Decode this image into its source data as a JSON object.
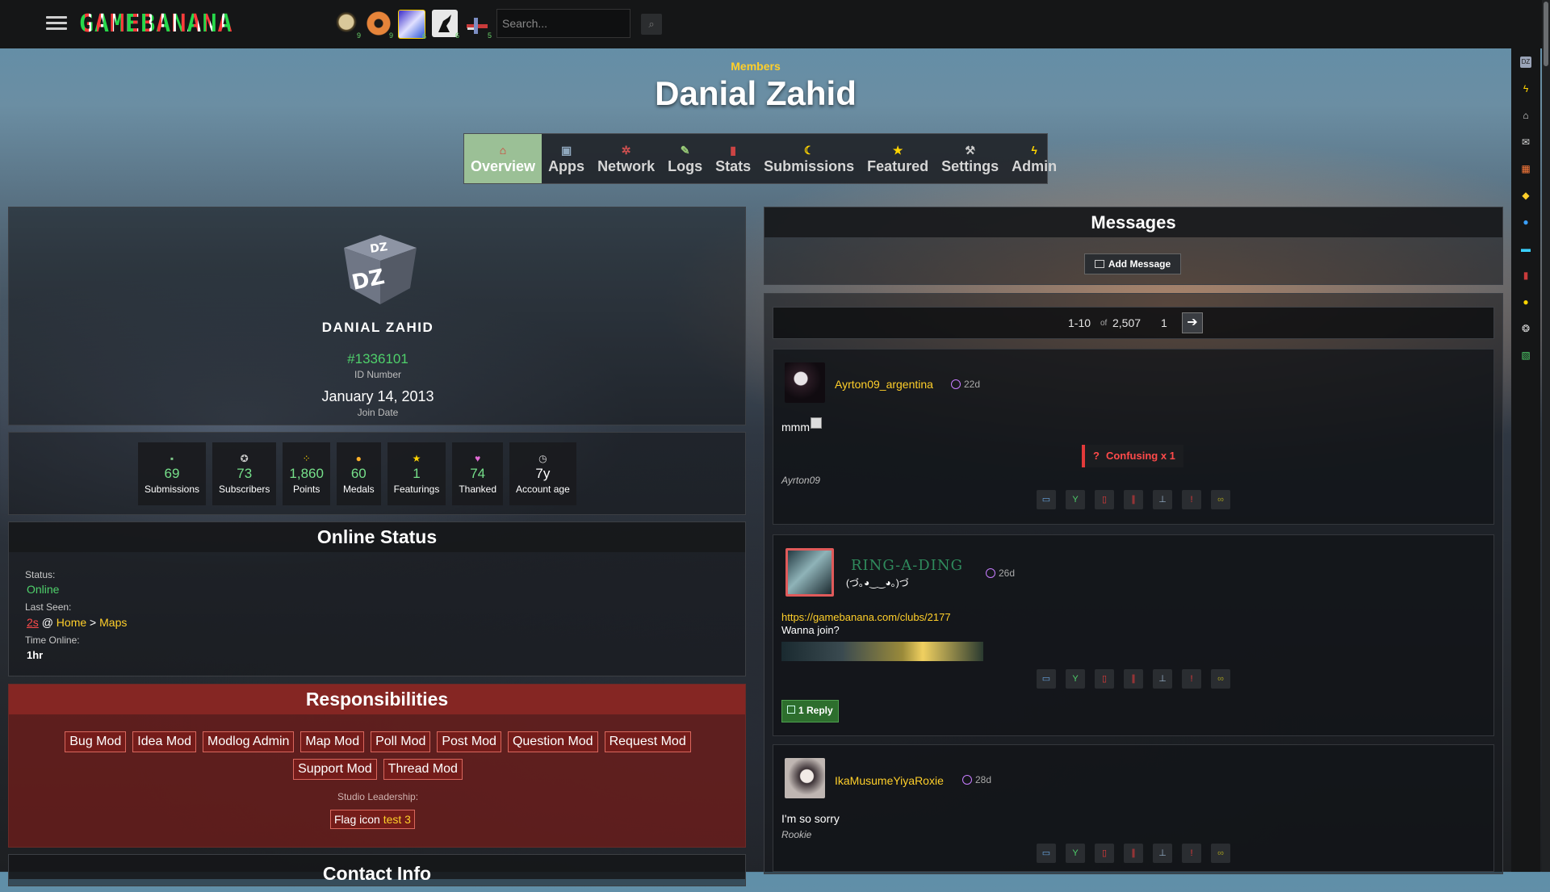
{
  "topbar": {
    "logo_text": "GAMEBANANA",
    "search_placeholder": "Search...",
    "game_badges": [
      "9",
      "9",
      "6",
      "6",
      "5"
    ],
    "game_icons": [
      "skull-game-icon",
      "tf2-game-icon",
      "sonic-game-icon",
      "cs-game-icon",
      "plane-game-icon"
    ]
  },
  "header": {
    "crumb": "Members",
    "title": "Danial Zahid"
  },
  "tabs": [
    {
      "label": "Overview",
      "icon": "home-icon",
      "glyph": "⌂"
    },
    {
      "label": "Apps",
      "icon": "apps-icon",
      "glyph": "▣"
    },
    {
      "label": "Network",
      "icon": "network-icon",
      "glyph": "✲"
    },
    {
      "label": "Logs",
      "icon": "logs-icon",
      "glyph": "✎"
    },
    {
      "label": "Stats",
      "icon": "stats-icon",
      "glyph": "▮"
    },
    {
      "label": "Submissions",
      "icon": "moon-icon",
      "glyph": "☾"
    },
    {
      "label": "Featured",
      "icon": "star-icon",
      "glyph": "★"
    },
    {
      "label": "Settings",
      "icon": "wrench-icon",
      "glyph": "⚒"
    },
    {
      "label": "Admin",
      "icon": "bolt-icon",
      "glyph": "ϟ"
    }
  ],
  "profile": {
    "avatar_text": "DZ",
    "username": "DANIAL ZAHID",
    "id": "#1336101",
    "id_label": "ID Number",
    "join_date": "January 14, 2013",
    "join_label": "Join Date"
  },
  "stats": [
    {
      "value": "69",
      "label": "Submissions",
      "icon": "submissions-icon",
      "glyph": "▪"
    },
    {
      "value": "73",
      "label": "Subscribers",
      "icon": "subscribers-icon",
      "glyph": "✪"
    },
    {
      "value": "1,860",
      "label": "Points",
      "icon": "points-icon",
      "glyph": "⁘"
    },
    {
      "value": "60",
      "label": "Medals",
      "icon": "medal-icon",
      "glyph": "●"
    },
    {
      "value": "1",
      "label": "Featurings",
      "icon": "star-icon",
      "glyph": "★"
    },
    {
      "value": "74",
      "label": "Thanked",
      "icon": "thanks-icon",
      "glyph": "♥"
    },
    {
      "value": "7y",
      "label": "Account age",
      "icon": "clock-icon",
      "glyph": "◷"
    }
  ],
  "online": {
    "heading": "Online Status",
    "status_label": "Status:",
    "status_value": "Online",
    "last_seen_label": "Last Seen:",
    "last_seen_time": "2s",
    "last_seen_at": "@",
    "last_seen_home": "Home",
    "last_seen_sep": ">",
    "last_seen_page": "Maps",
    "time_online_label": "Time Online:",
    "time_online_value": "1hr"
  },
  "responsibilities": {
    "heading": "Responsibilities",
    "roles": [
      "Bug Mod",
      "Idea Mod",
      "Modlog Admin",
      "Map Mod",
      "Poll Mod",
      "Post Mod",
      "Question Mod",
      "Request Mod",
      "Support Mod",
      "Thread Mod"
    ],
    "studio_label": "Studio Leadership:",
    "studio_alt": "Flag icon",
    "studio_name": "test 3"
  },
  "contact": {
    "heading": "Contact Info"
  },
  "messages": {
    "heading": "Messages",
    "add_label": "Add Message",
    "range": "1-10",
    "of": "of",
    "total": "2,507",
    "page": "1",
    "items": [
      {
        "user": "Ayrton09_argentina",
        "time": "22d",
        "text": "mmm",
        "sig": "Ayrton09",
        "reaction": "Confusing x 1"
      },
      {
        "user": "RING-A-DING",
        "subtitle": "(づ｡◕‿‿◕｡)づ",
        "time": "26d",
        "link": "https://gamebanana.com/clubs/2177",
        "text": "Wanna join?",
        "reply": "1 Reply"
      },
      {
        "user": "IkaMusumeYiyaRoxie",
        "time": "28d",
        "text": "I'm so sorry",
        "sig": "Rookie"
      }
    ]
  },
  "colors": {
    "accent_green": "#4fd06b",
    "accent_yellow": "#ffcf2a",
    "resp_red": "#6e1c1a"
  }
}
